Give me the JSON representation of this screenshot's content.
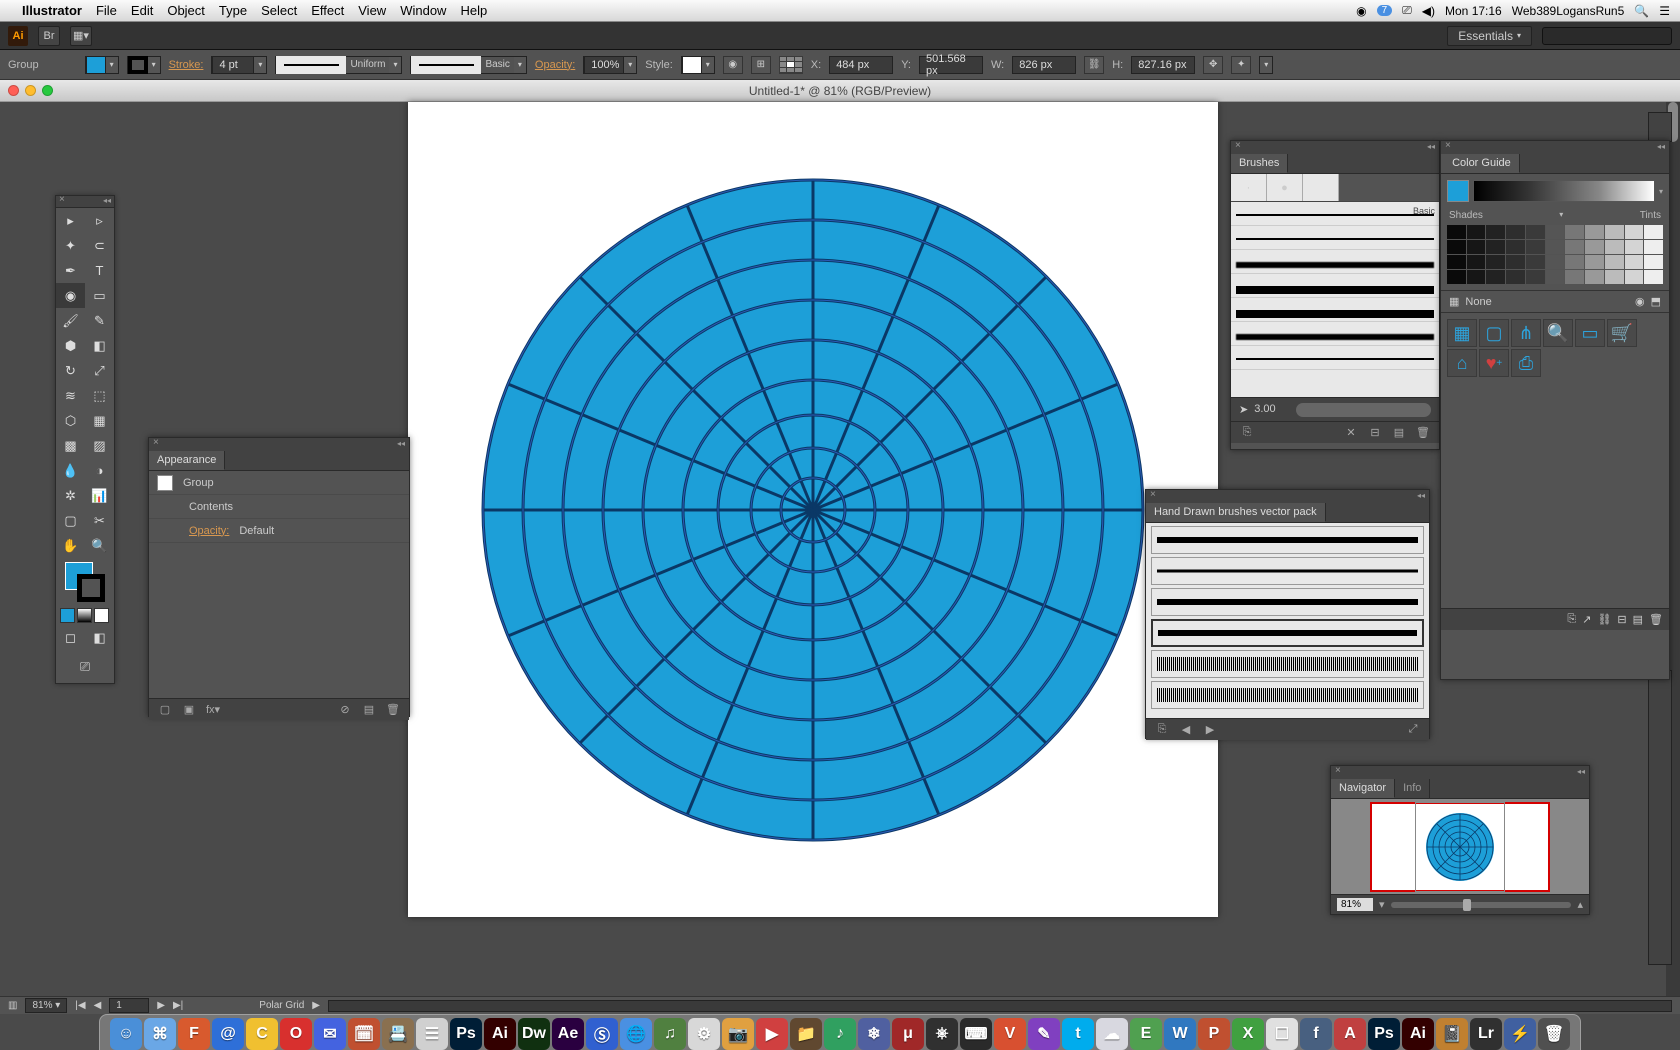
{
  "menubar": {
    "app": "Illustrator",
    "items": [
      "File",
      "Edit",
      "Object",
      "Type",
      "Select",
      "Effect",
      "View",
      "Window",
      "Help"
    ],
    "clock": "Mon 17:16",
    "user": "Web389LogansRun5",
    "cc_badge": "7"
  },
  "appbar": {
    "workspace": "Essentials"
  },
  "controlbar": {
    "selection": "Group",
    "stroke_label": "Stroke:",
    "stroke_weight": "4 pt",
    "brush_variance": "Uniform",
    "brush_def": "Basic",
    "opacity_label": "Opacity:",
    "opacity_value": "100%",
    "style_label": "Style:",
    "x_label": "X:",
    "x_value": "484 px",
    "y_label": "Y:",
    "y_value": "501.568 px",
    "w_label": "W:",
    "w_value": "826 px",
    "h_label": "H:",
    "h_value": "827.16 px",
    "fill_color": "#1d9fd8"
  },
  "doc": {
    "title": "Untitled-1* @ 81% (RGB/Preview)"
  },
  "panels": {
    "appearance": {
      "title": "Appearance",
      "object": "Group",
      "contents": "Contents",
      "opacity_label": "Opacity:",
      "opacity_value": "Default"
    },
    "brushes": {
      "title": "Brushes",
      "basic_label": "Basic",
      "stroke_size": "3.00"
    },
    "colorguide": {
      "title": "Color Guide",
      "shades": "Shades",
      "tints": "Tints",
      "rule": "None"
    },
    "handdrawn": {
      "title": "Hand Drawn brushes vector pack"
    },
    "navigator": {
      "title": "Navigator",
      "info_tab": "Info",
      "zoom": "81%"
    }
  },
  "statusbar": {
    "zoom": "81%",
    "artboard_nav": "1",
    "tool": "Polar Grid"
  },
  "dock_apps": [
    {
      "bg": "#4a8fd8",
      "t": "☺"
    },
    {
      "bg": "#6aa7e6",
      "t": "⌘"
    },
    {
      "bg": "#d85a2e",
      "t": "F"
    },
    {
      "bg": "#2e6fd8",
      "t": "@"
    },
    {
      "bg": "#f0c030",
      "t": "C"
    },
    {
      "bg": "#d8302e",
      "t": "O"
    },
    {
      "bg": "#4463e0",
      "t": "✉"
    },
    {
      "bg": "#c05030",
      "t": "🗓"
    },
    {
      "bg": "#8a7050",
      "t": "📇"
    },
    {
      "bg": "#d0d0d0",
      "t": "☰"
    },
    {
      "bg": "#001e36",
      "t": "Ps"
    },
    {
      "bg": "#330000",
      "t": "Ai"
    },
    {
      "bg": "#103010",
      "t": "Dw"
    },
    {
      "bg": "#2a0040",
      "t": "Ae"
    },
    {
      "bg": "#3060d0",
      "t": "Ⓢ"
    },
    {
      "bg": "#4a90e2",
      "t": "🌐"
    },
    {
      "bg": "#508040",
      "t": "♫"
    },
    {
      "bg": "#d8d8d8",
      "t": "⚙"
    },
    {
      "bg": "#e0a040",
      "t": "📷"
    },
    {
      "bg": "#d04040",
      "t": "▶"
    },
    {
      "bg": "#604830",
      "t": "📁"
    },
    {
      "bg": "#30a060",
      "t": "♪"
    },
    {
      "bg": "#5060a0",
      "t": "❄"
    },
    {
      "bg": "#a02828",
      "t": "μ"
    },
    {
      "bg": "#303030",
      "t": "⎈"
    },
    {
      "bg": "#2a2a2a",
      "t": "⌨"
    },
    {
      "bg": "#d85030",
      "t": "V"
    },
    {
      "bg": "#8040c0",
      "t": "✎"
    },
    {
      "bg": "#00aced",
      "t": "t"
    },
    {
      "bg": "#d8d8e0",
      "t": "☁"
    },
    {
      "bg": "#50a050",
      "t": "E"
    },
    {
      "bg": "#3078c0",
      "t": "W"
    },
    {
      "bg": "#c05030",
      "t": "P"
    },
    {
      "bg": "#40a040",
      "t": "X"
    },
    {
      "bg": "#e0e0e0",
      "t": "☐"
    },
    {
      "bg": "#486080",
      "t": "f"
    },
    {
      "bg": "#c04040",
      "t": "A"
    },
    {
      "bg": "#001e36",
      "t": "Ps"
    },
    {
      "bg": "#330000",
      "t": "Ai"
    },
    {
      "bg": "#c08030",
      "t": "📓"
    },
    {
      "bg": "#303030",
      "t": "Lr"
    },
    {
      "bg": "#4060a0",
      "t": "⚡"
    },
    {
      "bg": "#505050",
      "t": "🗑"
    }
  ]
}
